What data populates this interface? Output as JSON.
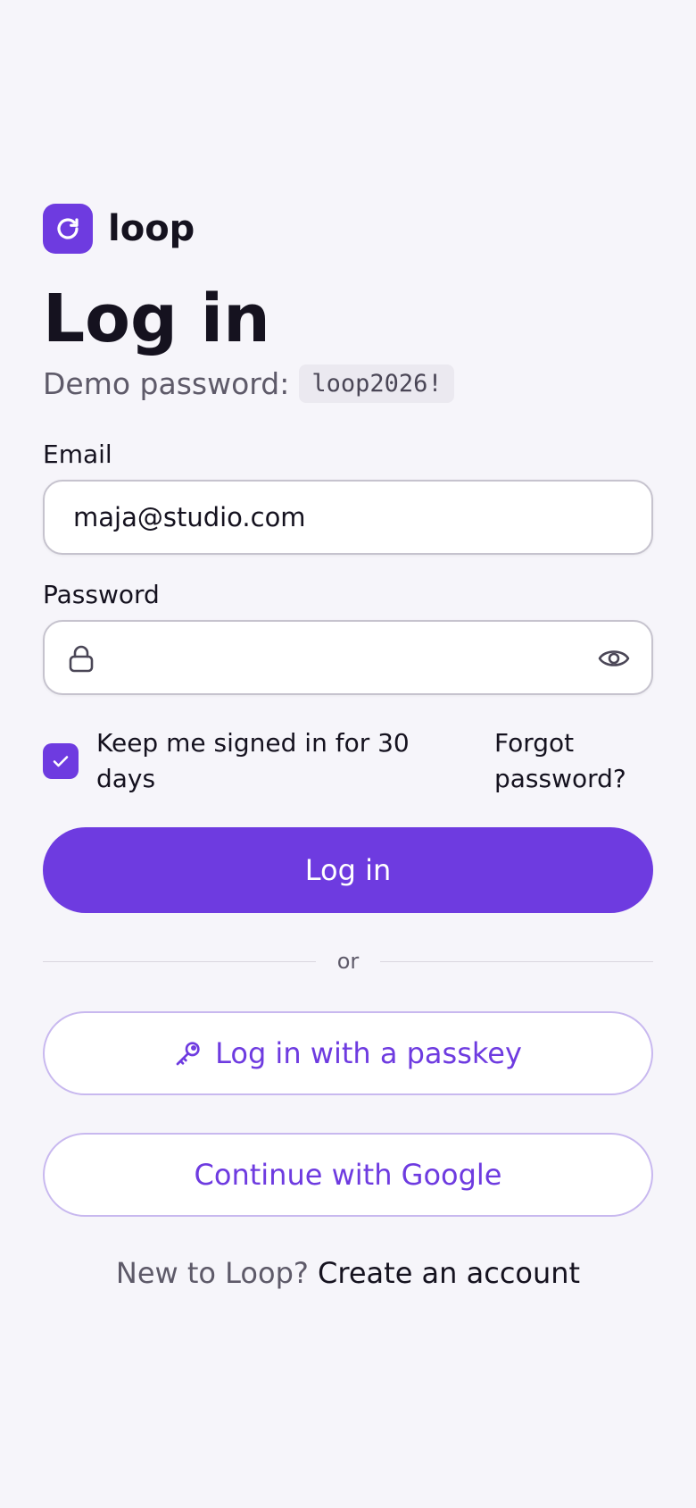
{
  "brand": {
    "name": "loop",
    "logo_icon": "refresh-icon",
    "accent_color": "#6e3be0"
  },
  "page": {
    "title": "Log in",
    "demo_label": "Demo password:",
    "demo_password": "loop2026!"
  },
  "form": {
    "email_label": "Email",
    "email_value": "maja@studio.com",
    "email_placeholder": "",
    "password_label": "Password",
    "password_value": "",
    "password_placeholder": "",
    "remember_label": "Keep me signed in for 30 days",
    "remember_checked": true,
    "forgot_label": "Forgot password?",
    "submit_label": "Log in"
  },
  "alternatives": {
    "or_label": "or",
    "passkey_label": "Log in with a passkey",
    "google_label": "Continue with Google"
  },
  "footer": {
    "prompt": "New to Loop?",
    "link": "Create an account"
  }
}
